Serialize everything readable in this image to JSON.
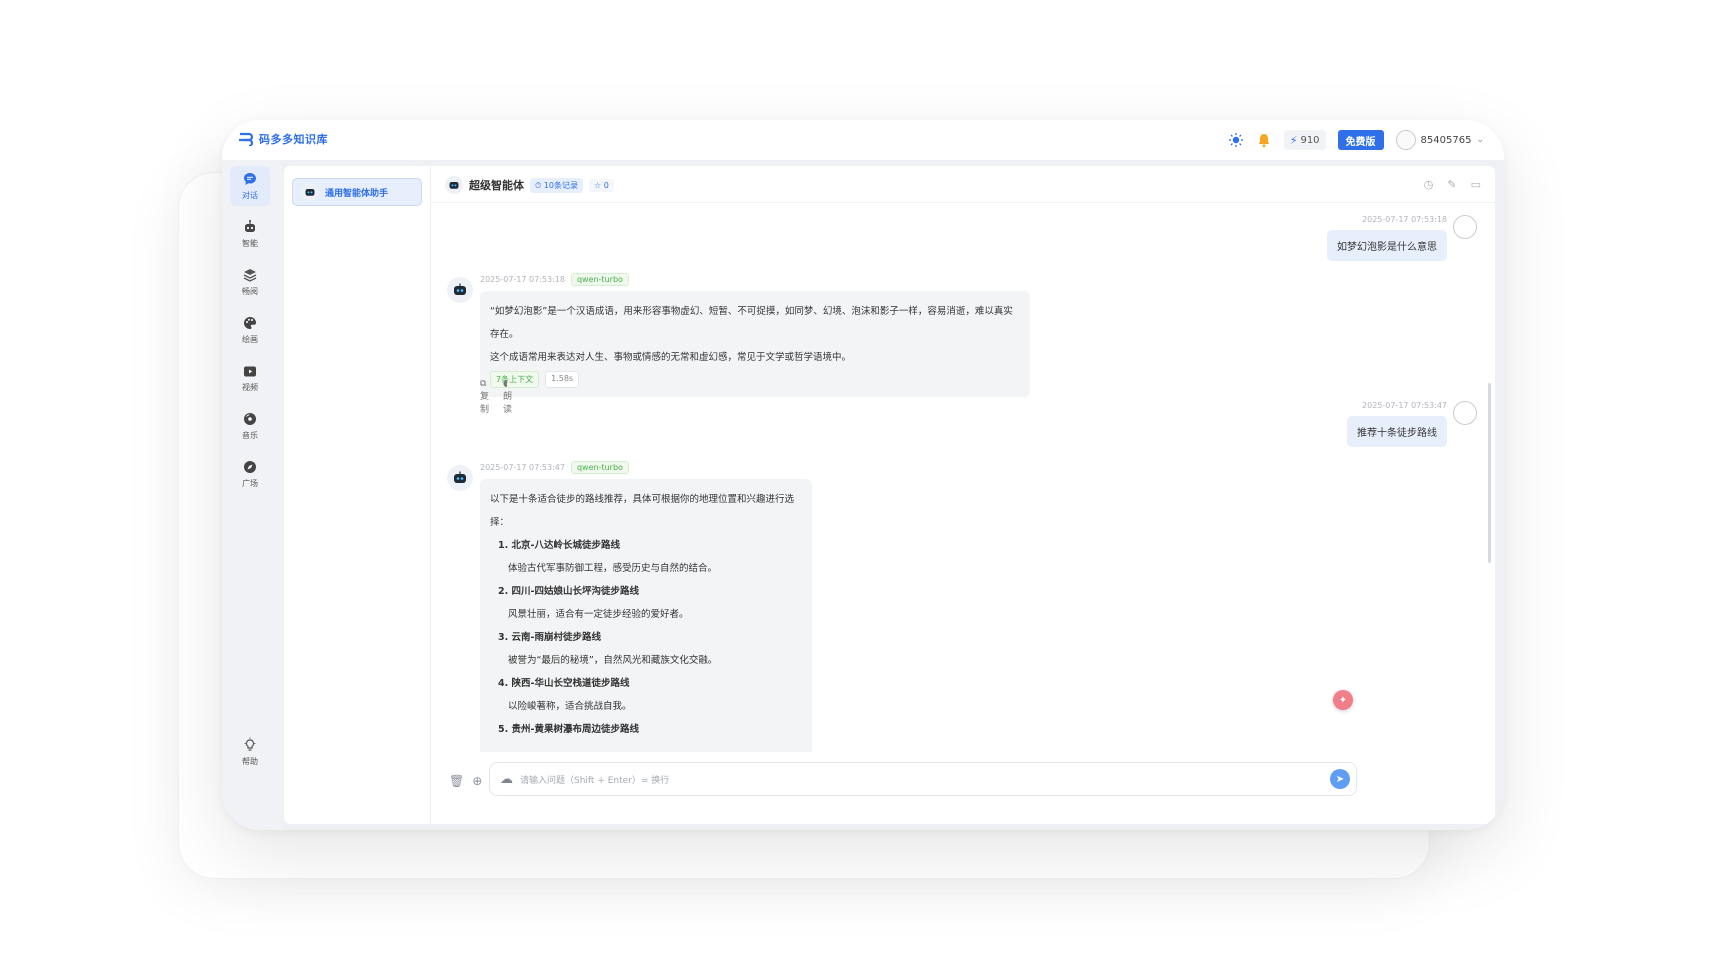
{
  "app": {
    "name": "码多多知识库",
    "brand_color": "#2f6fea"
  },
  "topbar": {
    "points": "910",
    "plan_label": "免费版",
    "username": "85405765"
  },
  "sidebar": {
    "items": [
      {
        "label": "对话",
        "icon": "chat-bubble-icon",
        "active": true
      },
      {
        "label": "智能",
        "icon": "robot-icon"
      },
      {
        "label": "畅阅",
        "icon": "layers-icon"
      },
      {
        "label": "绘画",
        "icon": "palette-icon"
      },
      {
        "label": "视频",
        "icon": "video-icon"
      },
      {
        "label": "音乐",
        "icon": "music-disc-icon"
      },
      {
        "label": "广场",
        "icon": "compass-icon"
      }
    ],
    "help_label": "帮助"
  },
  "agent_panel": {
    "selected_agent": "通用智能体助手"
  },
  "chat": {
    "title": "超级智能体",
    "records_badge": "10条记录",
    "favorites_badge": "0",
    "messages": [
      {
        "role": "user",
        "time": "2025-07-17 07:53:18",
        "text": "如梦幻泡影是什么意思"
      },
      {
        "role": "bot",
        "time": "2025-07-17 07:53:18",
        "model": "qwen-turbo",
        "paragraphs": [
          "“如梦幻泡影”是一个汉语成语，用来形容事物虚幻、短暂、不可捉摸，如同梦、幻境、泡沫和影子一样，容易消逝，难以真实存在。",
          "这个成语常用来表达对人生、事物或情感的无常和虚幻感，常见于文学或哲学语境中。"
        ],
        "context_chip": "7条上下文",
        "duration_chip": "1.58s",
        "actions": [
          "复制",
          "朗读"
        ]
      },
      {
        "role": "user",
        "time": "2025-07-17 07:53:47",
        "text": "推荐十条徒步路线"
      },
      {
        "role": "bot",
        "time": "2025-07-17 07:53:47",
        "model": "qwen-turbo",
        "intro": "以下是十条适合徒步的路线推荐，具体可根据你的地理位置和兴趣进行选择：",
        "routes": [
          {
            "title": "1. 北京-八达岭长城徒步路线",
            "desc": "体验古代军事防御工程，感受历史与自然的结合。"
          },
          {
            "title": "2. 四川-四姑娘山长坪沟徒步路线",
            "desc": "风景壮丽，适合有一定徒步经验的爱好者。"
          },
          {
            "title": "3. 云南-雨崩村徒步路线",
            "desc": "被誉为“最后的秘境”，自然风光和藏族文化交融。"
          },
          {
            "title": "4. 陕西-华山长空栈道徒步路线",
            "desc": "以险峻著称，适合挑战自我。"
          },
          {
            "title": "5. 贵州-黄果树瀑布周边徒步路线",
            "desc": ""
          }
        ]
      }
    ]
  },
  "composer": {
    "placeholder": "请输入问题（Shift + Enter）= 换行"
  }
}
